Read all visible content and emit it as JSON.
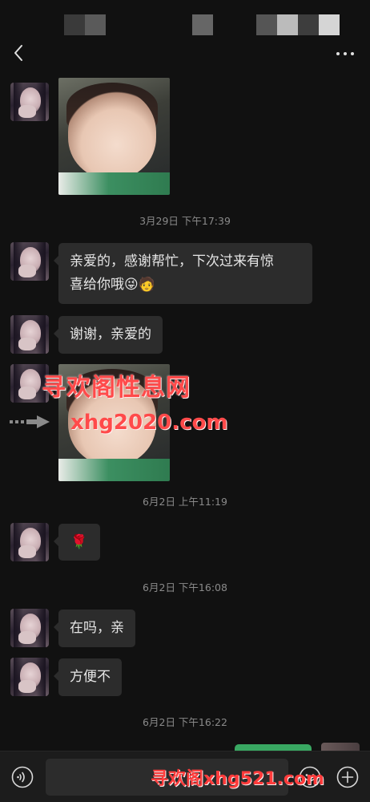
{
  "header": {
    "title_blocks_colors": [
      "#3a3a3a",
      "#5a5a5a",
      "#666666",
      "#555555",
      "#bbbbbb",
      "#3d3d3d",
      "#d5d5d5"
    ],
    "back_icon": "chevron-left-icon",
    "more_icon": "more-dots-icon"
  },
  "messages": [
    {
      "type": "image",
      "desc_icon": "child-photo"
    },
    {
      "type": "timestamp",
      "text": "3月29日 下午17:39"
    },
    {
      "type": "text",
      "line1": "亲爱的，感谢帮忙，下次过来有惊",
      "line2": "喜给你哦😜🧑"
    },
    {
      "type": "text",
      "text": "谢谢，亲爱的"
    },
    {
      "type": "image",
      "desc_icon": "child-photo"
    },
    {
      "type": "timestamp",
      "text": "6月2日 上午11:19"
    },
    {
      "type": "text",
      "text": "🌹"
    },
    {
      "type": "timestamp",
      "text": "6月2日 下午16:08"
    },
    {
      "type": "text",
      "text": "在吗，亲"
    },
    {
      "type": "text",
      "text": "方便不"
    },
    {
      "type": "timestamp",
      "text": "6月2日 下午16:22"
    }
  ],
  "watermarks": {
    "line1": "寻欢阁性息网",
    "line2": "xhg2020.com",
    "bottom": "寻欢阁xhg521.com"
  },
  "input_bar": {
    "placeholder": "",
    "value": "",
    "voice_icon": "voice-icon",
    "emoji_icon": "emoji-icon",
    "plus_icon": "plus-icon"
  },
  "colors": {
    "background": "#111111",
    "bubble": "#2c2c2c",
    "sent_bubble": "#39a862",
    "watermark": "#ff4a4a"
  }
}
